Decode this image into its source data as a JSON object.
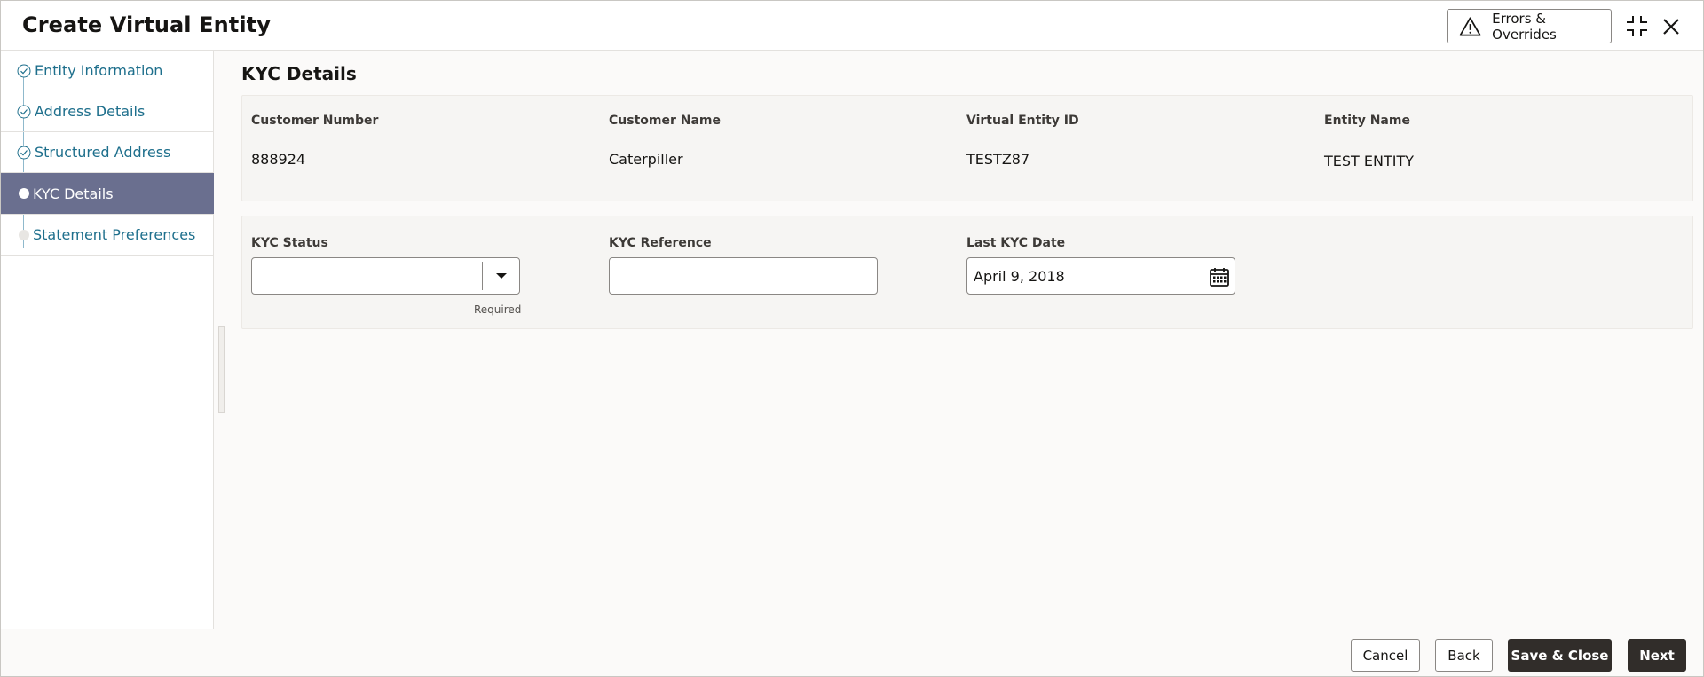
{
  "header": {
    "title": "Create Virtual Entity",
    "errors_label": "Errors & Overrides"
  },
  "sidebar": {
    "steps": [
      {
        "label": "Entity Information",
        "state": "completed"
      },
      {
        "label": "Address Details",
        "state": "completed"
      },
      {
        "label": "Structured Address",
        "state": "completed"
      },
      {
        "label": "KYC Details",
        "state": "active"
      },
      {
        "label": "Statement Preferences",
        "state": "pending"
      }
    ]
  },
  "main": {
    "section_title": "KYC Details",
    "summary": [
      {
        "label": "Customer Number",
        "value": "888924"
      },
      {
        "label": "Customer Name",
        "value": "Caterpiller"
      },
      {
        "label": "Virtual Entity ID",
        "value": "TESTZ87"
      },
      {
        "label": "Entity Name",
        "value": "TEST ENTITY"
      }
    ],
    "kyc_status": {
      "label": "KYC Status",
      "value": "",
      "helper": "Required"
    },
    "kyc_reference": {
      "label": "KYC Reference",
      "value": ""
    },
    "last_kyc_date": {
      "label": "Last KYC Date",
      "value": "April 9, 2018"
    }
  },
  "footer": {
    "cancel": "Cancel",
    "back": "Back",
    "save_close": "Save & Close",
    "next": "Next"
  },
  "colors": {
    "link": "#1e6f8c",
    "active_step_bg": "#6a6f8f",
    "primary_button": "#312d2a"
  }
}
